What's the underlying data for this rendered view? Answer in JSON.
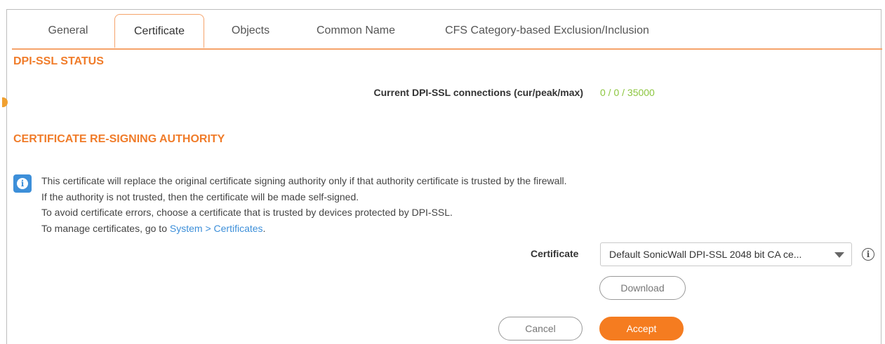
{
  "tabs": [
    {
      "label": "General",
      "active": false
    },
    {
      "label": "Certificate",
      "active": true
    },
    {
      "label": "Objects",
      "active": false
    },
    {
      "label": "Common Name",
      "active": false
    },
    {
      "label": "CFS Category-based Exclusion/Inclusion",
      "active": false
    }
  ],
  "status_section": {
    "title": "DPI-SSL STATUS",
    "connections_label": "Current DPI-SSL connections (cur/peak/max)",
    "connections_value": "0 / 0 / 35000"
  },
  "authority_section": {
    "title": "CERTIFICATE RE-SIGNING AUTHORITY",
    "info_lines": [
      "This certificate will replace the original certificate signing authority only if that authority certificate is trusted by the firewall.",
      "If the authority is not trusted, then the certificate will be made self-signed.",
      "To avoid certificate errors, choose a certificate that is trusted by devices protected by DPI-SSL."
    ],
    "manage_prefix": "To manage certificates, go to ",
    "manage_link": "System > Certificates",
    "manage_suffix": ".",
    "certificate_label": "Certificate",
    "certificate_value": "Default SonicWall DPI-SSL 2048 bit CA ce...",
    "download_label": "Download"
  },
  "actions": {
    "cancel_label": "Cancel",
    "accept_label": "Accept"
  },
  "colors": {
    "accent": "#f57c20",
    "status_green": "#8cc63f",
    "link_blue": "#3d8fd9"
  },
  "icons": [
    "info-icon",
    "help-icon",
    "chevron-down-icon"
  ]
}
